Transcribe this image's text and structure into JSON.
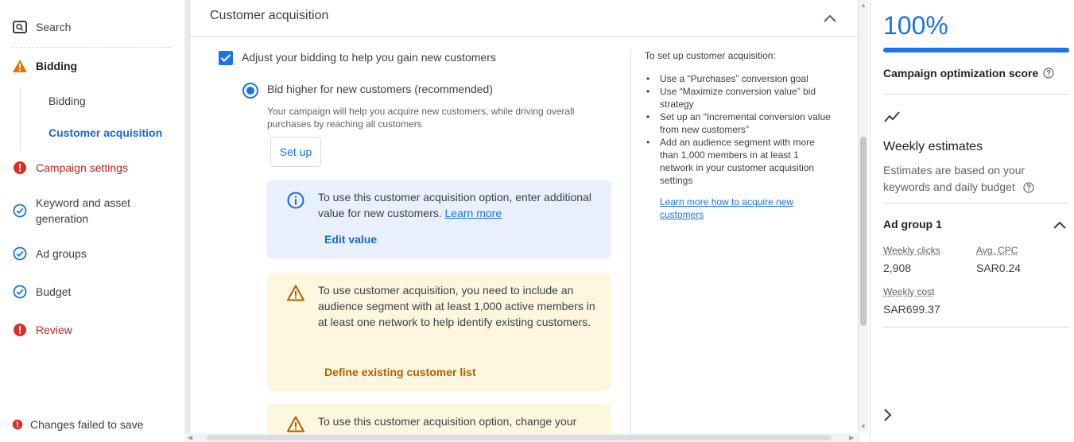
{
  "left_nav": {
    "search": "Search",
    "bidding": "Bidding",
    "sub_bidding": "Bidding",
    "sub_customer_acquisition": "Customer acquisition",
    "campaign_settings": "Campaign settings",
    "keyword_asset_line1": "Keyword and asset",
    "keyword_asset_line2": "generation",
    "ad_groups": "Ad groups",
    "budget": "Budget",
    "review": "Review",
    "footer_message": "Changes failed to save"
  },
  "main": {
    "card_title": "Customer acquisition",
    "checkbox_label": "Adjust your bidding to help you gain new customers",
    "radio_label": "Bid higher for new customers (recommended)",
    "radio_desc": "Your campaign will help you acquire new customers, while driving overall purchases by reaching all customers",
    "setup_button": "Set up",
    "info_box": {
      "text": "To use this customer acquisition option, enter additional value for new customers.",
      "link": "Learn more",
      "action": "Edit value"
    },
    "warn_box": {
      "text": "To use customer acquisition, you need to include an audience segment with at least 1,000 active members in at least one network to help identify existing customers.",
      "action": "Define existing customer list"
    },
    "warn_box2": {
      "text": "To use this customer acquisition option, change your"
    },
    "side_help": {
      "title": "To set up customer acquisition:",
      "items": [
        "Use a “Purchases” conversion goal",
        "Use “Maximize conversion value” bid strategy",
        "Set up an “Incremental conversion value from new customers”",
        "Add an audience segment with more than 1,000 members in at least 1 network in your customer acquisition settings"
      ],
      "link": "Learn more how to acquire new customers"
    }
  },
  "right_panel": {
    "score_value": "100%",
    "score_fraction": 1.0,
    "score_label": "Campaign optimization score",
    "weekly_title": "Weekly estimates",
    "weekly_desc": "Estimates are based on your keywords and daily budget",
    "ad_group_title": "Ad group 1",
    "weekly_clicks_label": "Weekly clicks",
    "weekly_clicks_value": "2,908",
    "avg_cpc_label": "Avg. CPC",
    "avg_cpc_value": "SAR0.24",
    "weekly_cost_label": "Weekly cost",
    "weekly_cost_value": "SAR699.37"
  },
  "colors": {
    "accent_blue": "#1a73e8",
    "error_red": "#d93025",
    "warning_orange": "#e37400",
    "info_bg": "#e8f0fe",
    "warn_bg": "#fef7e0"
  }
}
